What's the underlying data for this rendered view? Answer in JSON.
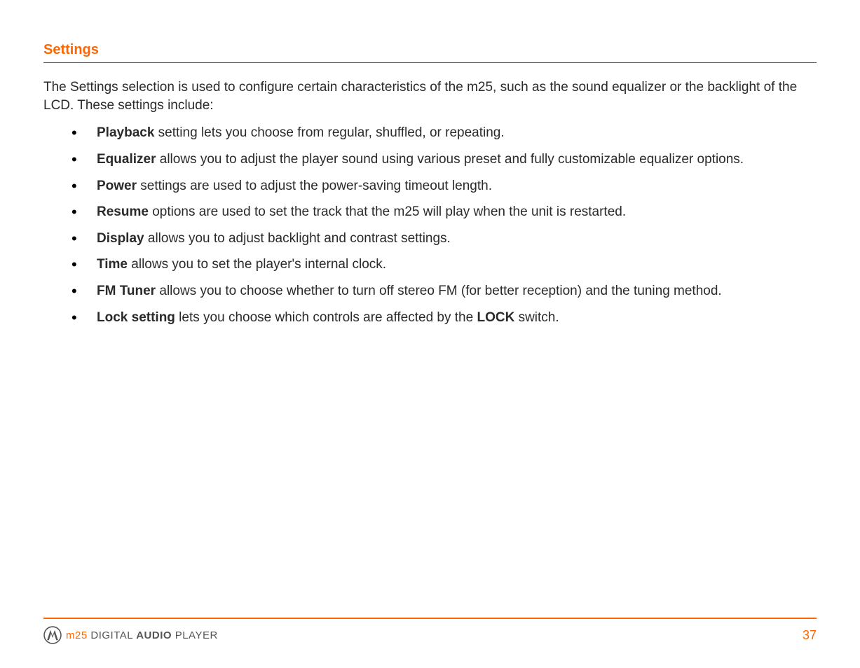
{
  "heading": "Settings",
  "intro": "The Settings selection is used to configure certain characteristics of the m25, such as the sound equalizer or the backlight of the LCD. These settings include:",
  "items": [
    {
      "term": "Playback",
      "rest": " setting lets you choose from regular, shuffled, or repeating."
    },
    {
      "term": "Equalizer",
      "rest": " allows you to adjust the player sound using various preset and fully customizable equalizer options."
    },
    {
      "term": "Power",
      "rest": " settings are used to adjust the power-saving timeout length."
    },
    {
      "term": "Resume",
      "rest": " options are used to set the track that the m25 will play when the unit is restarted."
    },
    {
      "term": "Display",
      "rest": " allows you to adjust backlight and contrast settings."
    },
    {
      "term": "Time",
      "rest": " allows you to set the player's internal clock."
    },
    {
      "term": "FM Tuner",
      "rest": " allows you to choose whether to turn off stereo FM (for better reception) and the tuning method."
    },
    {
      "term": "Lock setting",
      "rest_pre": " lets you choose which controls are affected by the ",
      "lock_word": "LOCK",
      "rest_post": " switch."
    }
  ],
  "footer": {
    "m25": "m25",
    "digital": " DIGITAL ",
    "audio": "AUDIO",
    "player": " PLAYER",
    "page_number": "37"
  }
}
